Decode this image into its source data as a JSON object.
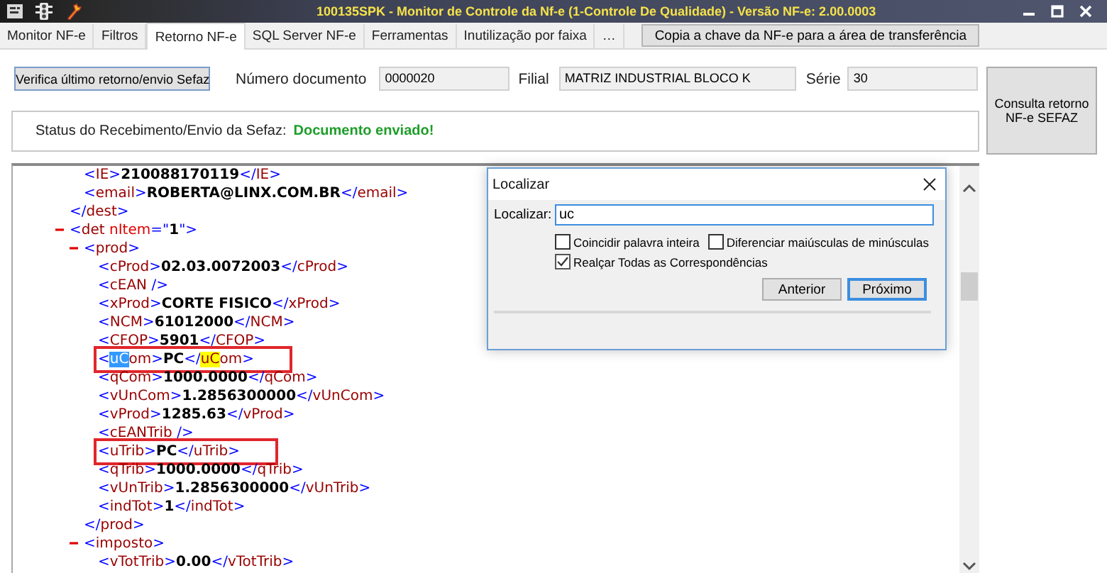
{
  "window": {
    "title": "100135SPK - Monitor de Controle da Nf-e (1-Controle De Qualidade) - Versão NF-e: 2.00.0003"
  },
  "tabs": [
    {
      "label": "Monitor NF-e",
      "selected": false
    },
    {
      "label": "Filtros",
      "selected": false
    },
    {
      "label": "Retorno NF-e",
      "selected": true
    },
    {
      "label": "SQL Server NF-e",
      "selected": false
    },
    {
      "label": "Ferramentas",
      "selected": false
    },
    {
      "label": "Inutilização por faixa",
      "selected": false
    },
    {
      "label": "…",
      "selected": false
    }
  ],
  "copy_button": "Copia a chave da NF-e para a área de transferência",
  "form": {
    "verify_button": "Verifica último retorno/envio Sefaz",
    "numero_label": "Número documento",
    "numero_value": "0000020",
    "filial_label": "Filial",
    "filial_value": "MATRIZ INDUSTRIAL BLOCO K",
    "serie_label": "Série",
    "serie_value": "30"
  },
  "status": {
    "label": "Status do Recebimento/Envio da Sefaz:",
    "value": "Documento enviado!"
  },
  "consult_button": "Consulta retorno NF-e SEFAZ",
  "xml": [
    {
      "children": [
        {
          "open": "<IE>",
          "value": "210088170119",
          "close": "</IE>"
        },
        {
          "open": "<email>",
          "value": "ROBERTA@LINX.COM.BR",
          "close": "</email>"
        }
      ],
      "close": "</dest>"
    },
    {
      "open": "<det nItem=\"1\">",
      "expanded": true,
      "children": [
        {
          "open": "<prod>",
          "expanded": true,
          "children": [
            {
              "open": "<cProd>",
              "value": "02.03.0072003",
              "close": "</cProd>"
            },
            {
              "open": "<cEAN />"
            },
            {
              "open": "<xProd>",
              "value": "CORTE FISICO",
              "close": "</xProd>"
            },
            {
              "open": "<NCM>",
              "value": "61012000",
              "close": "</NCM>"
            },
            {
              "open": "<CFOP>",
              "value": "5901",
              "close": "</CFOP>"
            },
            {
              "open": "<uCom>",
              "value": "PC",
              "close": "</uCom>",
              "open_selected": true,
              "close_highlighted": true,
              "boxed": true
            },
            {
              "open": "<qCom>",
              "value": "1000.0000",
              "close": "</qCom>"
            },
            {
              "open": "<vUnCom>",
              "value": "1.2856300000",
              "close": "</vUnCom>"
            },
            {
              "open": "<vProd>",
              "value": "1285.63",
              "close": "</vProd>"
            },
            {
              "open": "<cEANTrib />"
            },
            {
              "open": "<uTrib>",
              "value": "PC",
              "close": "</uTrib>",
              "boxed": true
            },
            {
              "open": "<qTrib>",
              "value": "1000.0000",
              "close": "</qTrib>"
            },
            {
              "open": "<vUnTrib>",
              "value": "1.2856300000",
              "close": "</vUnTrib>"
            },
            {
              "open": "<indTot>",
              "value": "1",
              "close": "</indTot>"
            }
          ],
          "close": "</prod>"
        },
        {
          "open": "<imposto>",
          "expanded": true,
          "children": [
            {
              "open": "<vTotTrib>",
              "value": "0.00",
              "close": "</vTotTrib>"
            }
          ]
        }
      ]
    }
  ],
  "find_dialog": {
    "title": "Localizar",
    "label": "Localizar:",
    "value": "uc",
    "options": [
      {
        "label": "Coincidir palavra inteira",
        "checked": false
      },
      {
        "label": "Diferenciar maiúsculas de minúsculas",
        "checked": false
      },
      {
        "label": "Realçar Todas as Correspondências",
        "checked": true
      }
    ],
    "buttons": [
      {
        "label": "Anterior",
        "default": false
      },
      {
        "label": "Próximo",
        "default": true
      }
    ]
  }
}
